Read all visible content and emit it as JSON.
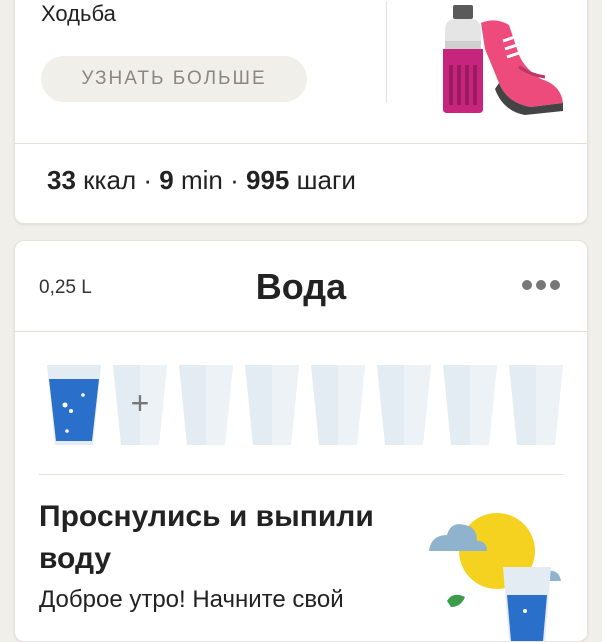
{
  "walk_card": {
    "title": "Ходьба",
    "learn_more_label": "УЗНАТЬ БОЛЬШЕ",
    "stats": {
      "calories_value": "33",
      "calories_unit": "ккал",
      "separator": "·",
      "minutes_value": "9",
      "minutes_unit": "min",
      "steps_value": "995",
      "steps_unit": "шаги"
    },
    "illustration_icon": "water-bottle-and-sneaker-icon"
  },
  "water_card": {
    "amount": "0,25 L",
    "title": "Вода",
    "menu_icon": "more-dots-icon",
    "glasses": {
      "total": 8,
      "filled": 1,
      "add_glyph": "+"
    },
    "tip_title": "Проснулись и выпили воду",
    "tip_body": "Доброе утро! Начните свой",
    "tip_illustration_icon": "sun-clouds-water-glass-icon"
  },
  "colors": {
    "background": "#f1efea",
    "card": "#ffffff",
    "water_blue": "#2a6fc9",
    "empty_glass": "#e3ebf3",
    "button_bg": "#f1efea",
    "button_text": "#8a8781",
    "bottle_magenta": "#c7257d",
    "sneaker_pink": "#ec4b7c",
    "sun_yellow": "#f4d21f",
    "cloud_blue": "#8fb3cc"
  }
}
